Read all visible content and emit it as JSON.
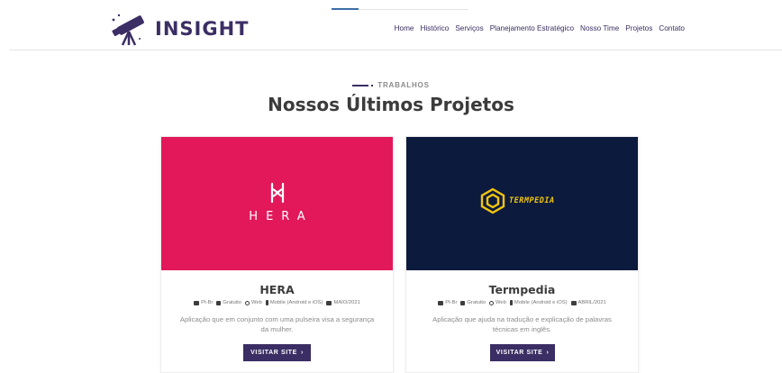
{
  "header": {
    "brand": "INSIGHT",
    "nav": [
      "Home",
      "Histórico",
      "Serviços",
      "Planejamento Estratégico",
      "Nosso Time",
      "Projetos",
      "Contato"
    ]
  },
  "section": {
    "eyebrow": "TRABALHOS",
    "title": "Nossos Últimos Projetos"
  },
  "projects": [
    {
      "name": "HERA",
      "logo_text": "HERA",
      "meta": [
        "Pt-Br",
        "Gratuito",
        "Web",
        "Mobile (Android e iOS)",
        "MAIO/2021"
      ],
      "description": "Aplicação que em conjunto com uma pulseira visa a segurança da mulher.",
      "button": "VISITAR SITE"
    },
    {
      "name": "Termpedia",
      "logo_text": "TERMPEDIA",
      "meta": [
        "Pt-Br",
        "Gratuito",
        "Web",
        "Mobile (Android e iOS)",
        "ABRIL/2021"
      ],
      "description": "Aplicação que ajuda na tradução e explicação de palavras técnicas em inglês.",
      "button": "VISITAR SITE"
    }
  ],
  "colors": {
    "brand_purple": "#3b2e64",
    "hera_pink": "#e2185b",
    "termpedia_navy": "#0c1a3d",
    "termpedia_yellow": "#f1c40f"
  },
  "icons": {
    "logo": "telescope-icon",
    "meta": [
      "language-icon",
      "bag-icon",
      "globe-icon",
      "phone-icon",
      "calendar-icon"
    ],
    "button": "chevron-right-icon"
  }
}
